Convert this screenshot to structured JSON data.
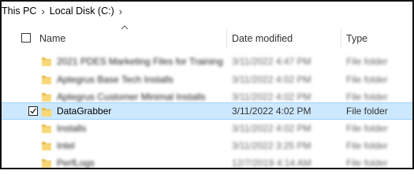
{
  "breadcrumb": {
    "items": [
      "This PC",
      "Local Disk (C:)"
    ],
    "separator": "›"
  },
  "columns": {
    "name": "Name",
    "date_modified": "Date modified",
    "type": "Type"
  },
  "rows": [
    {
      "name": "2021 PDES Marketing Files for Training",
      "date": "3/11/2022 4:47 PM",
      "type": "File folder",
      "blurred": true
    },
    {
      "name": "Aptegrus Base Tech Installs",
      "date": "3/11/2022 4:02 PM",
      "type": "File folder",
      "blurred": true
    },
    {
      "name": "Aptegrus Customer Minimal Installs",
      "date": "3/11/2022 4:02 PM",
      "type": "File folder",
      "blurred": true
    },
    {
      "name": "DataGrabber",
      "date": "3/11/2022 4:02 PM",
      "type": "File folder",
      "blurred": false,
      "selected": true
    },
    {
      "name": "Installs",
      "date": "3/11/2022 4:02 PM",
      "type": "File folder",
      "blurred": true
    },
    {
      "name": "Intel",
      "date": "3/11/2022 3:25 PM",
      "type": "File folder",
      "blurred": true
    },
    {
      "name": "PerfLogs",
      "date": "12/7/2019 4:14 AM",
      "type": "File folder",
      "blurred": true
    }
  ],
  "colors": {
    "selection_bg": "#cce8ff",
    "selection_border": "#99d1ff",
    "folder": "#f8d775"
  }
}
